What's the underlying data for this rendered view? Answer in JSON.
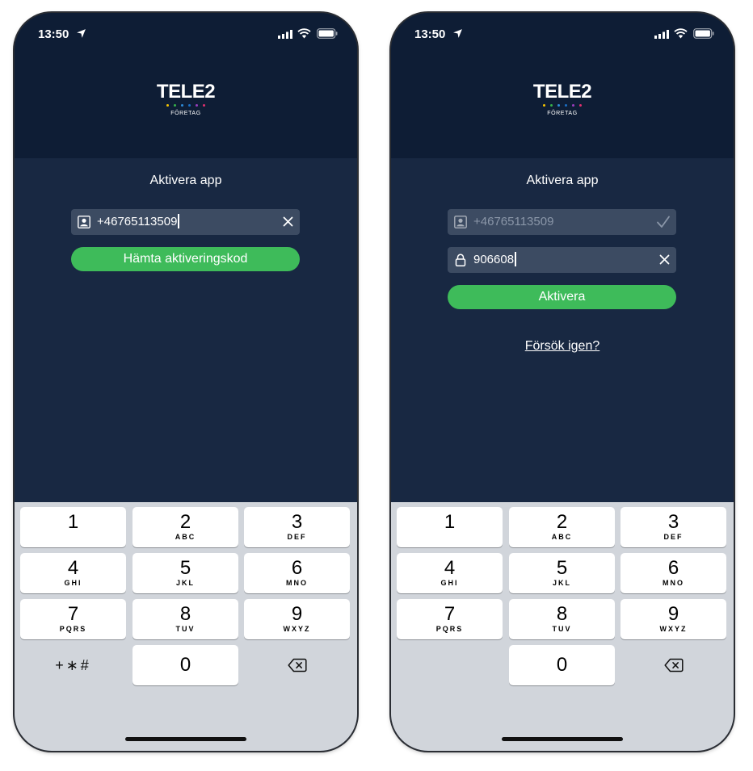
{
  "screens": [
    {
      "status": {
        "time": "13:50"
      },
      "logo": {
        "wordmark": "TELE2",
        "sub": "FÖRETAG"
      },
      "title": "Aktivera app",
      "phone_field": {
        "value": "+46765113509",
        "icon": "contact-card-icon",
        "action_icon": "clear-icon"
      },
      "button_label": "Hämta aktiveringskod",
      "keyboard": {
        "keys": [
          {
            "digit": "1",
            "letters": ""
          },
          {
            "digit": "2",
            "letters": "ABC"
          },
          {
            "digit": "3",
            "letters": "DEF"
          },
          {
            "digit": "4",
            "letters": "GHI"
          },
          {
            "digit": "5",
            "letters": "JKL"
          },
          {
            "digit": "6",
            "letters": "MNO"
          },
          {
            "digit": "7",
            "letters": "PQRS"
          },
          {
            "digit": "8",
            "letters": "TUV"
          },
          {
            "digit": "9",
            "letters": "WXYZ"
          },
          {
            "digit": "0",
            "letters": ""
          }
        ],
        "symbols_label": "+∗#"
      }
    },
    {
      "status": {
        "time": "13:50"
      },
      "logo": {
        "wordmark": "TELE2",
        "sub": "FÖRETAG"
      },
      "title": "Aktivera app",
      "phone_field": {
        "value": "+46765113509",
        "icon": "contact-card-icon",
        "action_icon": "checkmark-icon"
      },
      "code_field": {
        "value": "906608",
        "icon": "lock-icon",
        "action_icon": "clear-icon"
      },
      "button_label": "Aktivera",
      "retry_link": "Försök igen?",
      "keyboard": {
        "keys": [
          {
            "digit": "1",
            "letters": ""
          },
          {
            "digit": "2",
            "letters": "ABC"
          },
          {
            "digit": "3",
            "letters": "DEF"
          },
          {
            "digit": "4",
            "letters": "GHI"
          },
          {
            "digit": "5",
            "letters": "JKL"
          },
          {
            "digit": "6",
            "letters": "MNO"
          },
          {
            "digit": "7",
            "letters": "PQRS"
          },
          {
            "digit": "8",
            "letters": "TUV"
          },
          {
            "digit": "9",
            "letters": "WXYZ"
          },
          {
            "digit": "0",
            "letters": ""
          }
        ]
      }
    }
  ],
  "colors": {
    "header_bg": "#0e1d35",
    "screen_bg": "#182842",
    "field_bg": "#3c4b62",
    "accent_green": "#3ebb5a",
    "keyboard_bg": "#d1d5db",
    "logo_dots": [
      "#f5c400",
      "#36b24a",
      "#2e8bd8",
      "#1a6fc4",
      "#9b3dbf",
      "#e0306e"
    ]
  }
}
